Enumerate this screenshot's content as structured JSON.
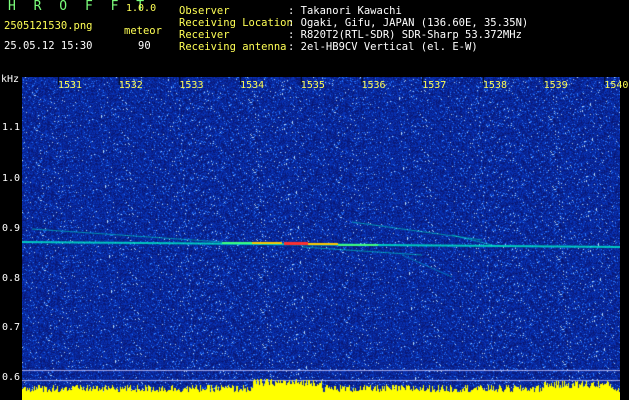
{
  "header": {
    "logo": "H R O F F T",
    "version": "1.0.0",
    "filename": "2505121530.png",
    "mode": "meteor",
    "datetime": "25.05.12 15:30",
    "count": "90",
    "observer_label": "Observer",
    "observer_value": ": Takanori Kawachi",
    "location_label": "Receiving Location",
    "location_value": ": Ogaki, Gifu, JAPAN (136.60E, 35.35N)",
    "receiver_label": "Receiver",
    "receiver_value": ": R820T2(RTL-SDR) SDR-Sharp 53.372MHz",
    "antenna_label": "Receiving antenna",
    "antenna_value": ": 2el-HB9CV Vertical (el. E-W)"
  },
  "axis": {
    "unit": "kHz",
    "y_ticks": [
      "1.1",
      "1.0",
      "0.9",
      "0.8",
      "0.7",
      "0.6"
    ],
    "x_ticks": [
      "1531",
      "1532",
      "1533",
      "1534",
      "1535",
      "1536",
      "1537",
      "1538",
      "1539",
      "1540"
    ]
  },
  "colors": {
    "background_noise": "#0a1a9a",
    "signal": "#00ffff",
    "peak": "#ff3030",
    "bars": "#ffff00"
  }
}
